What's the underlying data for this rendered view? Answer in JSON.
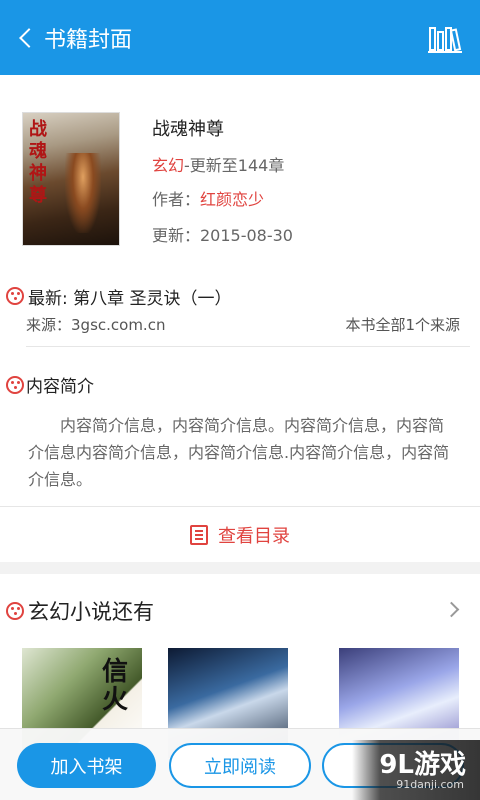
{
  "header": {
    "title": "书籍封面",
    "back_icon": "chevron-left-icon",
    "shelf_icon": "bookshelf-icon",
    "bg_color": "#1a96e6"
  },
  "book": {
    "cover_title": "战魂神尊",
    "name": "战魂神尊",
    "genre": "玄幻",
    "progress": "-更新至144章",
    "author_label": "作者：",
    "author": "红颜恋少",
    "update": "更新：2015-08-30"
  },
  "latest": {
    "label": "最新: 第八章 圣灵诀（一）",
    "source": "来源：3gsc.com.cn",
    "source_count": "本书全部1个来源"
  },
  "intro": {
    "title": "内容简介",
    "text": "内容简介信息，内容简介信息。内容简介信息，内容简介信息内容简介信息，内容简介信息.内容简介信息，内容简介信息。"
  },
  "catalog": {
    "label": "查看目录",
    "icon": "catalog-icon",
    "accent": "#e0433f"
  },
  "more": {
    "title": "玄幻小说还有",
    "chevron_icon": "chevron-right-icon",
    "covers": [
      {
        "text": "信\n火"
      },
      {
        "text": ""
      },
      {
        "text": ""
      }
    ]
  },
  "bottom": {
    "add_label": "加入书架",
    "read_label": "立即阅读"
  },
  "watermark": {
    "main": "9L游戏",
    "sub": "91danji.com"
  }
}
